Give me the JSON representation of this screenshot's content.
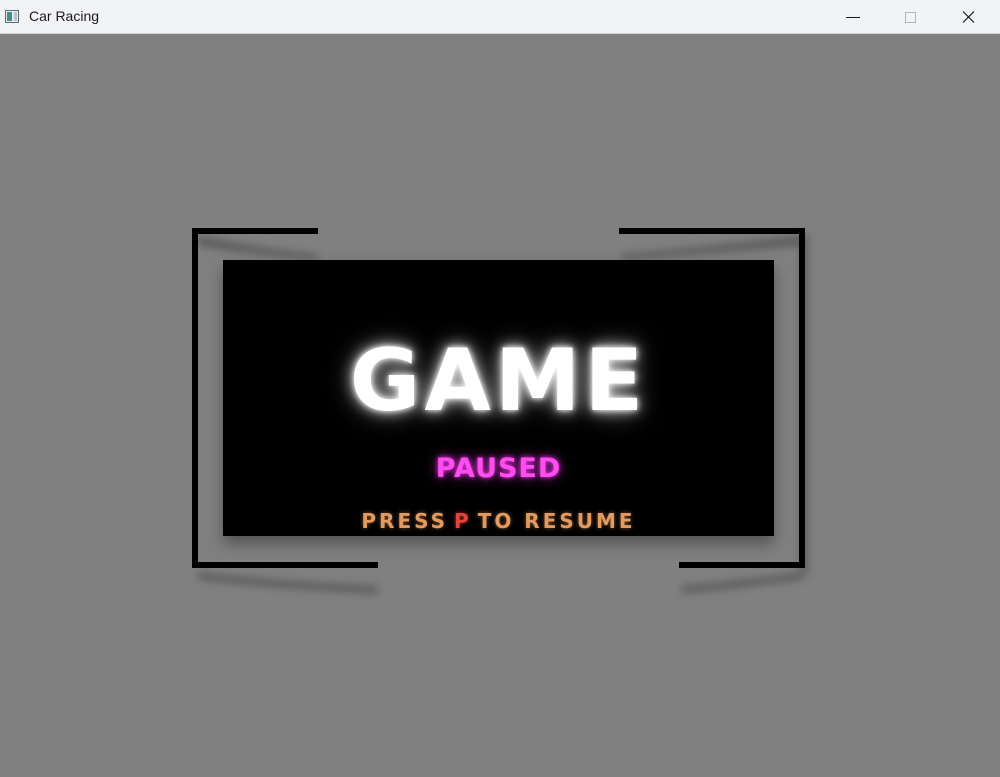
{
  "window": {
    "title": "Car Racing",
    "controls": {
      "minimize_icon": "minimize-icon",
      "maximize_icon": "maximize-icon",
      "close_icon": "close-icon"
    }
  },
  "pause_screen": {
    "headline": "GAME",
    "subheadline": "PAUSED",
    "instruction_before": "PRESS",
    "instruction_key": "P",
    "instruction_after": "TO RESUME"
  },
  "colors": {
    "background": "#808080",
    "panel": "#000000",
    "headline": "#ffffff",
    "subheadline": "#ff4df0",
    "instruction": "#e39a5e",
    "key": "#e3443a"
  }
}
